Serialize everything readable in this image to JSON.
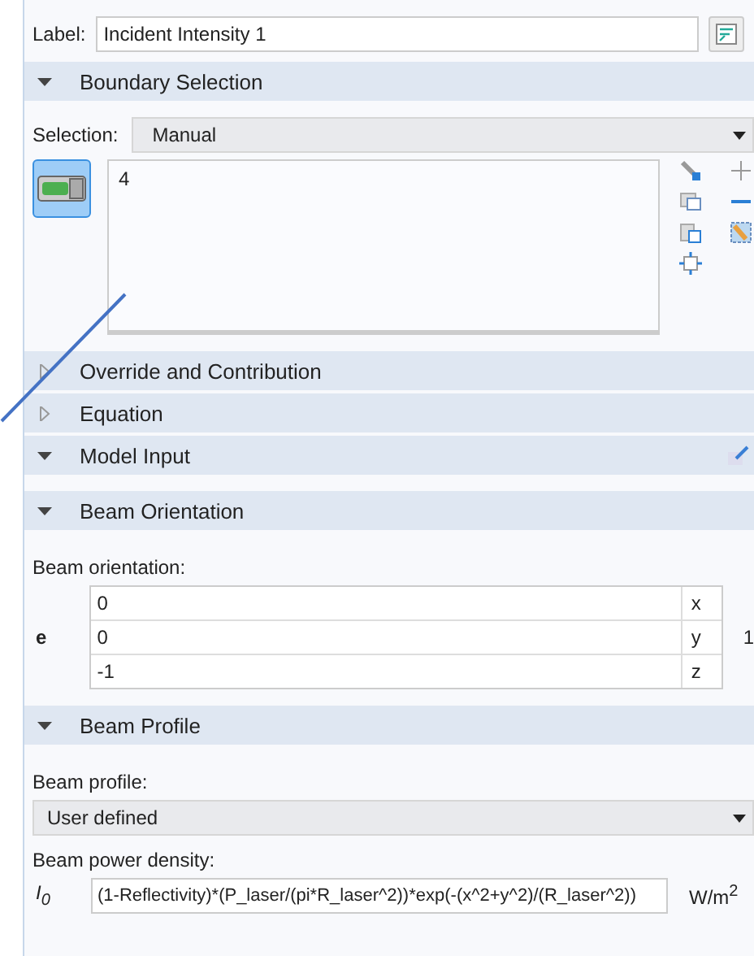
{
  "label": {
    "caption": "Label:",
    "value": "Incident Intensity 1"
  },
  "sections": [
    {
      "kind": "boundary",
      "title": "Boundary Selection",
      "expanded": true,
      "selection_caption": "Selection:",
      "selection_value": "Manual",
      "entities": [
        "4"
      ],
      "active": true
    },
    {
      "kind": "plain",
      "title": "Override and Contribution",
      "expanded": false
    },
    {
      "kind": "plain",
      "title": "Equation",
      "expanded": false
    },
    {
      "kind": "model_input",
      "title": "Model Input",
      "expanded": true
    },
    {
      "kind": "vector",
      "title": "Beam Orientation",
      "expanded": true,
      "caption": "Beam orientation:",
      "symbol": "e",
      "unit": "1",
      "rows": [
        {
          "value": "0",
          "axis": "x"
        },
        {
          "value": "0",
          "axis": "y"
        },
        {
          "value": "-1",
          "axis": "z"
        }
      ]
    },
    {
      "kind": "profile",
      "title": "Beam Profile",
      "expanded": true,
      "caption": "Beam profile:",
      "choice": "User defined",
      "density_caption": "Beam power density:",
      "symbol": "I$_{0}$",
      "expression": "(1-Reflectivity)*(P_laser/(pi*R_laser^2))*exp(-(x^2+y^2)/(R_laser^2))",
      "unit": "W/m$^{2}$"
    }
  ]
}
